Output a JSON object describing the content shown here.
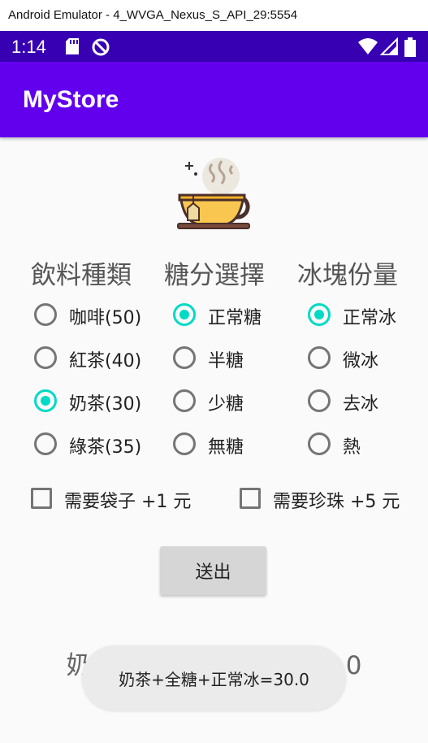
{
  "window": {
    "title": "Android Emulator - 4_WVGA_Nexus_S_API_29:5554"
  },
  "status_bar": {
    "time": "1:14",
    "icons_left": [
      "sd-card-icon",
      "no-sync-icon"
    ],
    "icons_right": [
      "wifi-icon",
      "signal-icon",
      "battery-icon"
    ]
  },
  "app_bar": {
    "title": "MyStore",
    "color": "#6200ee"
  },
  "colors": {
    "accent": "#03dac5",
    "status_bar": "#3700b3"
  },
  "columns": [
    {
      "header": "飲料種類",
      "options": [
        {
          "label": "咖啡(50)",
          "checked": false
        },
        {
          "label": "紅茶(40)",
          "checked": false
        },
        {
          "label": "奶茶(30)",
          "checked": true
        },
        {
          "label": "綠茶(35)",
          "checked": false
        }
      ]
    },
    {
      "header": "糖分選擇",
      "options": [
        {
          "label": "正常糖",
          "checked": true
        },
        {
          "label": "半糖",
          "checked": false
        },
        {
          "label": "少糖",
          "checked": false
        },
        {
          "label": "無糖",
          "checked": false
        }
      ]
    },
    {
      "header": "冰塊份量",
      "options": [
        {
          "label": "正常冰",
          "checked": true
        },
        {
          "label": "微冰",
          "checked": false
        },
        {
          "label": "去冰",
          "checked": false
        },
        {
          "label": "熱",
          "checked": false
        }
      ]
    }
  ],
  "checkboxes": [
    {
      "label": "需要袋子 +1 元",
      "checked": false
    },
    {
      "label": "需要珍珠 +5 元",
      "checked": false
    }
  ],
  "submit_label": "送出",
  "result_text": "奶茶+全糖+正常冰=30.0",
  "toast_text": "奶茶+全糖+正常冰=30.0"
}
